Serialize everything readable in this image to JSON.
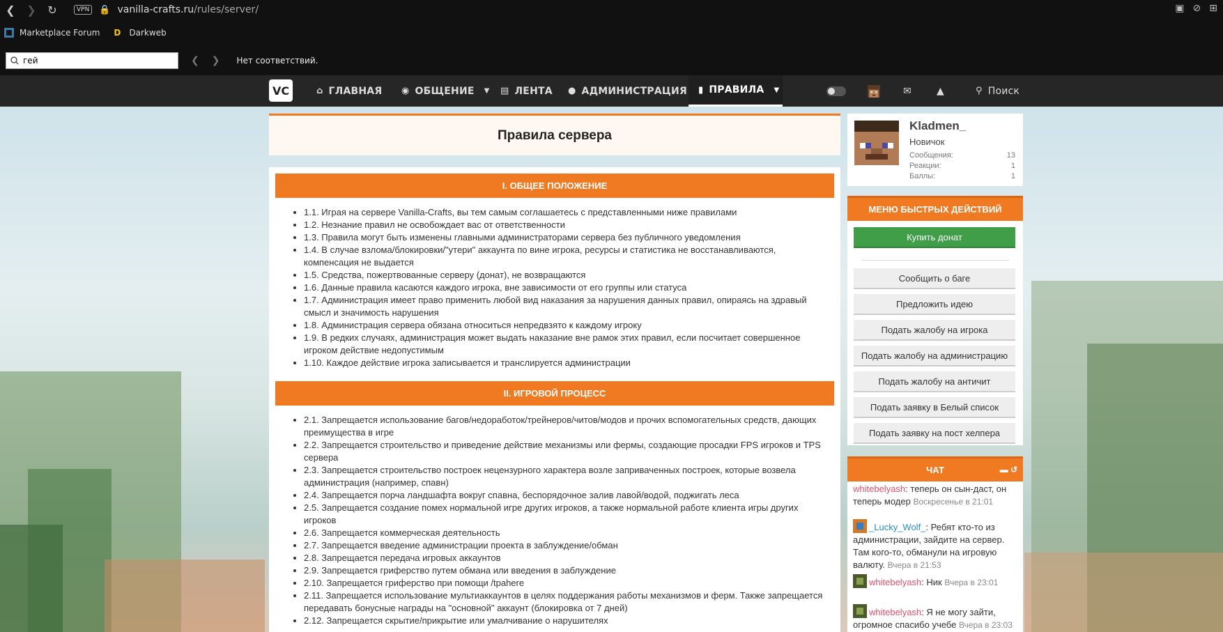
{
  "browser": {
    "url_domain": "vanilla-crafts.ru",
    "url_path": "/rules/server/",
    "vpn_label": "VPN",
    "bookmarks": [
      "Marketplace Forum",
      "Darkweb"
    ],
    "find_value": "гей",
    "find_status": "Нет соответствий."
  },
  "nav": {
    "logo": "VC",
    "items": [
      "ГЛАВНАЯ",
      "ОБЩЕНИЕ",
      "ЛЕНТА",
      "АДМИНИСТРАЦИЯ",
      "ПРАВИЛА"
    ],
    "search": "Поиск"
  },
  "page": {
    "title": "Правила сервера",
    "sections": [
      {
        "heading": "I. ОБЩЕЕ ПОЛОЖЕНИЕ",
        "rules": [
          "1.1. Играя на сервере Vanilla-Crafts, вы тем самым соглашаетесь с представленными ниже правилами",
          "1.2. Незнание правил не освобождает вас от ответственности",
          "1.3. Правила могут быть изменены главными администраторами сервера без публичного уведомления",
          "1.4. В случае взлома/блокировки/\"утери\" аккаунта по вине игрока, ресурсы и статистика не восстанавливаются, компенсация не выдается",
          "1.5. Средства, пожертвованные серверу (донат), не возвращаются",
          "1.6. Данные правила касаются каждого игрока, вне зависимости от его группы или статуса",
          "1.7. Администрация имеет право применить любой вид наказания за нарушения данных правил, опираясь на здравый смысл и значимость нарушения",
          "1.8. Администрация сервера обязана относиться непредвзято к каждому игроку",
          "1.9. В редких случаях, администрация может выдать наказание вне рамок этих правил, если посчитает совершенное игроком действие недопустимым",
          "1.10. Каждое действие игрока записывается и транслируется администрации"
        ]
      },
      {
        "heading": "II. ИГРОВОЙ ПРОЦЕСС",
        "rules": [
          "2.1. Запрещается использование багов/недоработок/трейнеров/читов/модов и прочих вспомогательных средств, дающих преимущества в игре",
          "2.2. Запрещается строительство и приведение действие механизмы или фермы, создающие просадки FPS игроков и TPS сервера",
          "2.3. Запрещается строительство построек нецензурного характера возле заприваченных построек, которые возвела администрация (например, спавн)",
          "2.4. Запрещается порча ландшафта вокруг спавна, беспорядочное залив лавой/водой, поджигать леса",
          "2.5. Запрещается создание помех нормальной игре других игроков, а также нормальной работе клиента игры других игроков",
          "2.6. Запрещается коммерческая деятельность",
          "2.7. Запрещается введение администрации проекта в заблуждение/обман",
          "2.8. Запрещается передача игровых аккаунтов",
          "2.9. Запрещается гриферство путем обмана или введения в заблуждение",
          "2.10. Запрещается гриферство при помощи /tpahere",
          "2.11. Запрещается использование мультиаккаунтов в целях поддержания работы механизмов и ферм. Также запрещается передавать бонусные награды на \"основной\" аккаунт (блокировка от 7 дней)",
          "2.12. Запрещается скрытие/прикрытие или умалчивание о нарушителях"
        ]
      }
    ]
  },
  "user": {
    "name": "Kladmen_",
    "rank": "Новичок",
    "stats": [
      {
        "label": "Сообщения:",
        "value": "13"
      },
      {
        "label": "Реакции:",
        "value": "1"
      },
      {
        "label": "Баллы:",
        "value": "1"
      }
    ]
  },
  "quick": {
    "heading": "МЕНЮ БЫСТРЫХ ДЕЙСТВИЙ",
    "buy": "Купить донат",
    "buttons": [
      "Сообщить о баге",
      "Предложить идею",
      "Подать жалобу на игрока",
      "Подать жалобу на администрацию",
      "Подать жалобу на античит",
      "Подать заявку в Белый список",
      "Подать заявку на пост хелпера"
    ]
  },
  "chat": {
    "heading": "ЧАТ",
    "messages": [
      {
        "user": "whitebelyash",
        "text": ": теперь он сын-даст, он теперь модер",
        "time": "Воскресенье в 21:01"
      },
      {
        "user": "_Lucky_Wolf_",
        "text": ": Ребят кто-то из администрации, зайдите на сервер. Там кого-то, обманули на игровую валюту.",
        "time": "Вчера в 21:53"
      },
      {
        "user": "whitebelyash",
        "text": ": Ник",
        "time": "Вчера в 23:01"
      },
      {
        "user": "whitebelyash",
        "text": ": Я не могу зайти, огромное спасибо учебе",
        "time": "Вчера в 23:03"
      }
    ]
  }
}
